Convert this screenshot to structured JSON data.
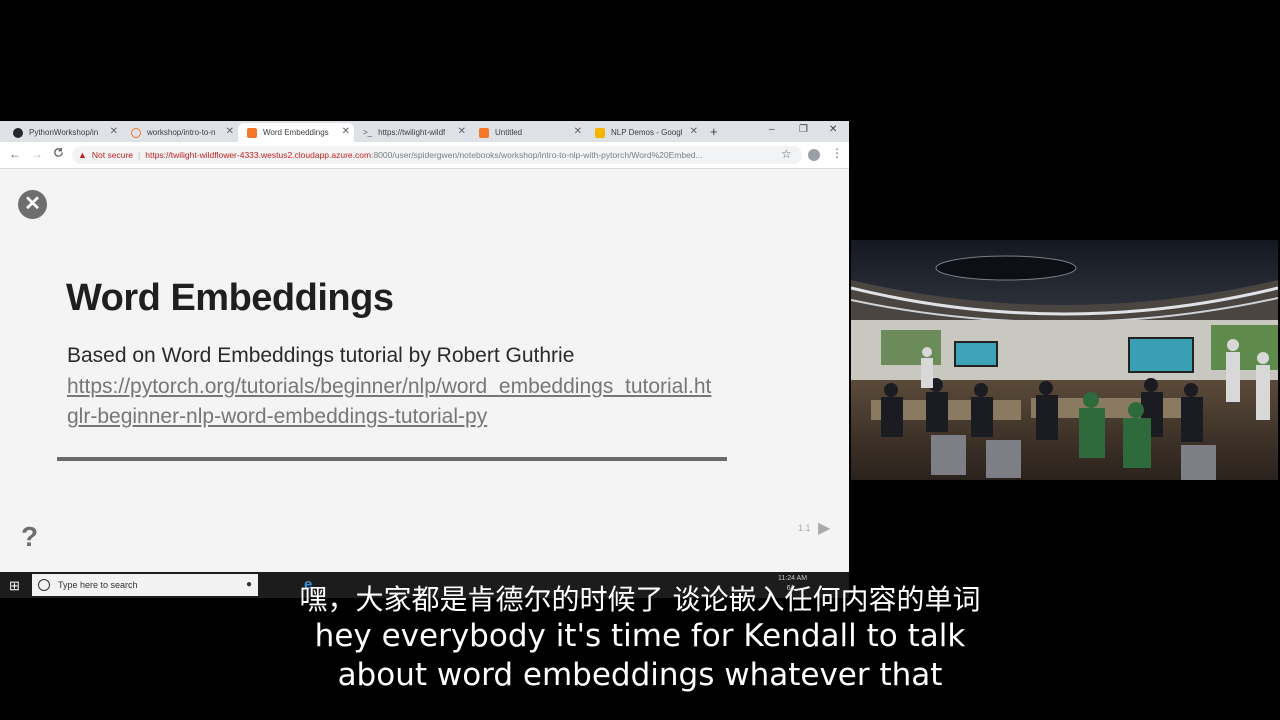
{
  "browser": {
    "tabs": [
      {
        "title": "PythonWorkshop/in",
        "favicon_color": "#24292e"
      },
      {
        "title": "workshop/intro-to-n",
        "favicon_color": "#f37726"
      },
      {
        "title": "Word Embeddings",
        "favicon_color": "#f37726",
        "active": true
      },
      {
        "title": "https://twilight-wildf",
        "favicon_color": "#333333"
      },
      {
        "title": "Untitled",
        "favicon_color": "#f37726"
      },
      {
        "title": "NLP Demos - Googl",
        "favicon_color": "#f4b400"
      }
    ],
    "new_tab": "+",
    "window_controls": {
      "minimize": "–",
      "maximize": "❐",
      "close": "✕"
    },
    "toolbar": {
      "back": "←",
      "forward": "→",
      "reload": "C"
    },
    "omnibox": {
      "security_icon": "▲",
      "security_label": "Not secure",
      "url_host": "https://twilight-wildflower-4333.westus2.cloudapp.azure.com",
      "url_path": ":8000/user/spidergwen/notebooks/workshop/intro-to-nlp-with-pytorch/Word%20Embed..."
    }
  },
  "slide": {
    "close_icon": "✕",
    "title": "Word Embeddings",
    "subtitle": "Based on Word Embeddings tutorial by Robert Guthrie",
    "link_line1": "https://pytorch.org/tutorials/beginner/nlp/word_embeddings_tutorial.ht",
    "link_line2": "glr-beginner-nlp-word-embeddings-tutorial-py",
    "help": "?",
    "page": "1.1",
    "next_icon": "▶"
  },
  "taskbar": {
    "start_icon": "⊞",
    "search_placeholder": "Type here to search",
    "mic_icon": "🎤",
    "edge_icon": "e",
    "time": "11:24 AM",
    "date": "6/..."
  },
  "subtitles": {
    "zh": "嘿，大家都是肯德尔的时候了 谈论嵌入任何内容的单词",
    "en_line1": "hey everybody it's time for Kendall to talk",
    "en_line2": "about word embeddings whatever that"
  }
}
